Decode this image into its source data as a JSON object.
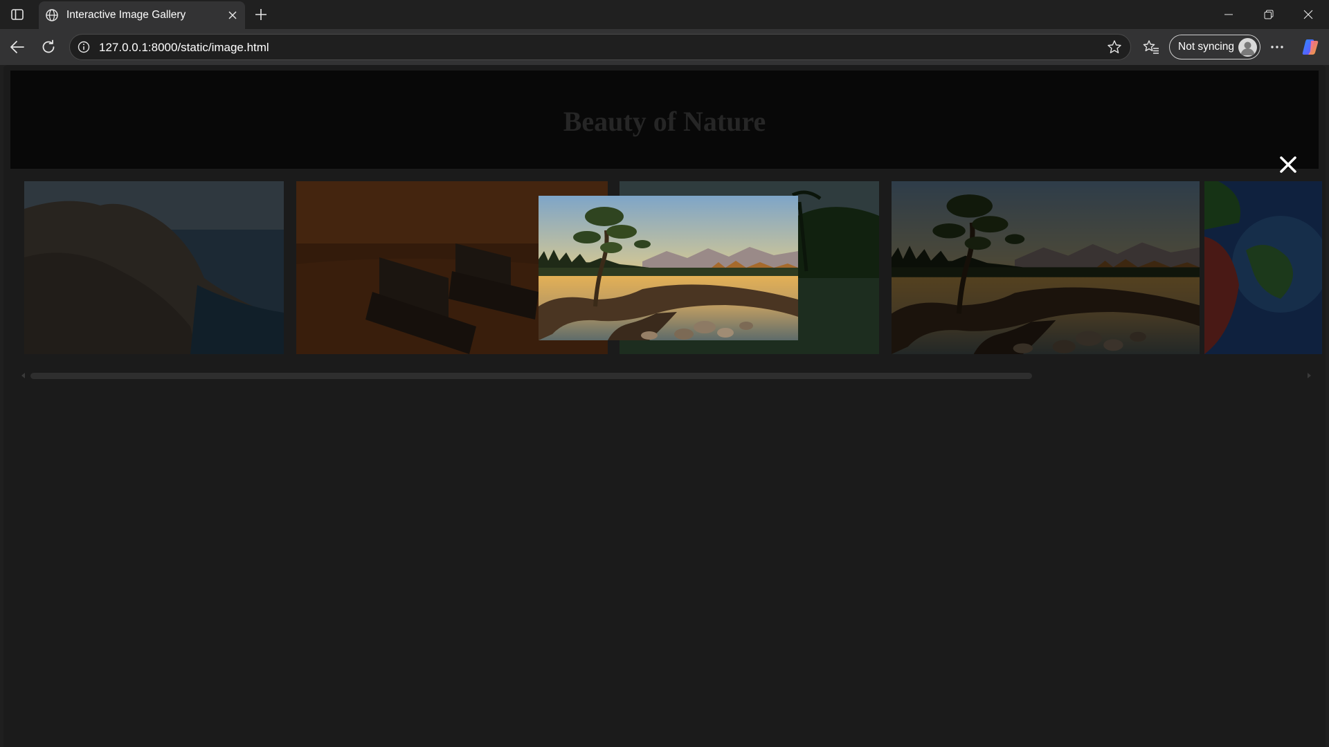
{
  "browser": {
    "tab_title": "Interactive Image Gallery",
    "url": "127.0.0.1:8000/static/image.html",
    "sync_label": "Not syncing",
    "icons": {
      "sidebar": "sidebar-toggle-icon",
      "tab": "globe-icon",
      "back": "back-arrow-icon",
      "reload": "reload-icon",
      "info": "site-info-icon",
      "favorite": "star-icon",
      "favorites": "favorites-icon",
      "more": "more-icon",
      "copilot": "copilot-icon"
    }
  },
  "page": {
    "title": "Beauty of Nature",
    "background": "#1b1b1b",
    "header_background": "#080808",
    "overlay_opacity": 0.63
  },
  "gallery": {
    "images": [
      {
        "subject": "coastal cliffs",
        "active": false
      },
      {
        "subject": "park benches in autumn",
        "active": false
      },
      {
        "subject": "tropical lake reflection",
        "active": false
      },
      {
        "subject": "tree over lake at sunset",
        "active": true
      },
      {
        "subject": "hands holding globe",
        "active": false
      }
    ]
  },
  "lightbox": {
    "open": true,
    "image_subject": "tree over lake at sunset",
    "close_glyph": "✕"
  }
}
